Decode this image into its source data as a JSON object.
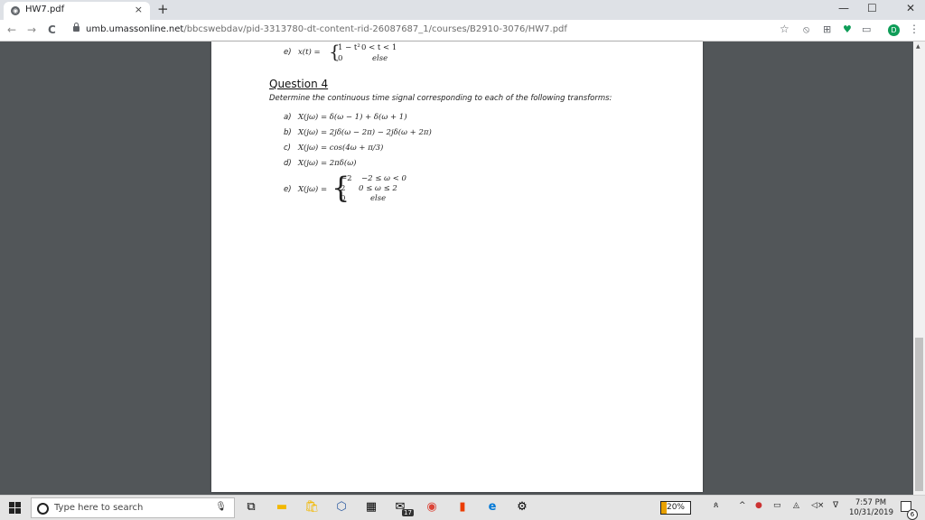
{
  "browser": {
    "tab_title": "HW7.pdf",
    "tab_close": "×",
    "new_tab": "+",
    "window_controls": {
      "minimize": "—",
      "maximize": "☐",
      "close": "✕"
    },
    "nav": {
      "back": "←",
      "forward": "→",
      "reload": "C"
    },
    "url_host": "umb.umassonline.net",
    "url_path": "/bbcswebdav/pid-3313780-dt-content-rid-26087687_1/courses/B2910-3076/HW7.pdf",
    "star_icon": "☆",
    "extensions": [
      "⦸",
      "⊞",
      "♥",
      "▭"
    ],
    "profile_initial": "D",
    "menu_icon": "⋮"
  },
  "document": {
    "prev_item": {
      "label": "e)",
      "lhs": "x(t) =",
      "case1_expr": "1 − t²",
      "case1_cond": "0 < t < 1",
      "case2_expr": "0",
      "case2_cond": "else"
    },
    "question_title": "Question 4",
    "question_desc": "Determine the continuous time signal corresponding to each of the following transforms:",
    "items": [
      {
        "label": "a)",
        "expr": "X(jω) = δ(ω − 1) + δ(ω + 1)"
      },
      {
        "label": "b)",
        "expr": "X(jω) = 2jδ(ω − 2π) − 2jδ(ω + 2π)"
      },
      {
        "label": "c)",
        "expr": "X(jω) = cos(4ω + π/3)"
      },
      {
        "label": "d)",
        "expr": "X(jω) = 2πδ(ω)"
      }
    ],
    "item_e": {
      "label": "e)",
      "lhs": "X(jω) =",
      "cases": [
        {
          "expr": "−2",
          "cond": "−2 ≤ ω < 0"
        },
        {
          "expr": "2",
          "cond": "0 ≤ ω ≤ 2"
        },
        {
          "expr": "0",
          "cond": "else"
        }
      ]
    }
  },
  "taskbar": {
    "search_placeholder": "Type here to search",
    "mail_badge": "17",
    "battery": "20%",
    "time": "7:57 PM",
    "date": "10/31/2019",
    "notification_count": "6"
  }
}
